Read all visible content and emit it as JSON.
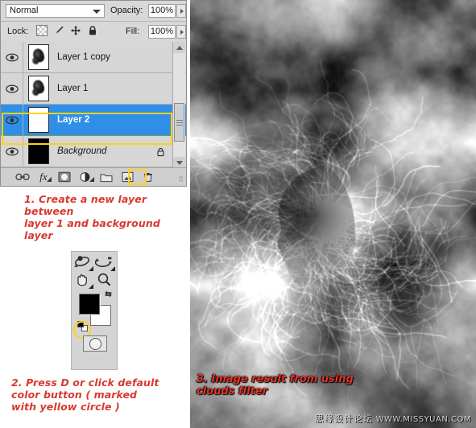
{
  "layers_panel": {
    "blend_mode": "Normal",
    "opacity_label": "Opacity:",
    "opacity_value": "100%",
    "lock_label": "Lock:",
    "lock_icons": [
      "lock-transparency-icon",
      "lock-image-pixels-icon",
      "lock-position-icon",
      "lock-all-icon"
    ],
    "fill_label": "Fill:",
    "fill_value": "100%",
    "layers": [
      {
        "name": "Layer 1 copy",
        "visible": true,
        "selected": false,
        "thumb": "blob",
        "locked": false,
        "italic": false
      },
      {
        "name": "Layer 1",
        "visible": true,
        "selected": false,
        "thumb": "blob",
        "locked": false,
        "italic": false
      },
      {
        "name": "Layer 2",
        "visible": true,
        "selected": true,
        "thumb": "empty",
        "locked": false,
        "italic": false
      },
      {
        "name": "Background",
        "visible": true,
        "selected": false,
        "thumb": "black",
        "locked": true,
        "italic": true
      }
    ],
    "toolbar_buttons": [
      "link-layers-icon",
      "layer-style-fx-icon",
      "add-layer-mask-icon",
      "new-adjustment-layer-icon",
      "new-group-icon",
      "new-layer-icon",
      "delete-layer-icon"
    ],
    "highlighted_button": "new-layer-icon"
  },
  "tools_palette": {
    "tools": [
      "rotate-3d-tool",
      "roll-3d-tool",
      "hand-tool",
      "zoom-tool"
    ],
    "foreground_color": "#000000",
    "background_color": "#ffffff",
    "swap_icon": "swap-colors-icon",
    "default_icon": "default-colors-icon",
    "quick_mask_icon": "quick-mask-mode-icon",
    "highlight_color": "#ffd21a"
  },
  "captions": {
    "step1": "1. Create a new layer between\nlayer 1 and background layer",
    "step2": "2. Press D or click default\ncolor button ( marked\nwith yellow circle )",
    "step3": "3. Image result from using\nclouds filter"
  },
  "watermark": {
    "cn": "思缘设计论坛",
    "url": "WWW.MISSYUAN.COM"
  },
  "colors": {
    "selection_blue": "#2f8fe8",
    "highlight_yellow": "#ffd21a",
    "caption_red": "#d9392f",
    "panel_gray": "#d4d4d4"
  }
}
